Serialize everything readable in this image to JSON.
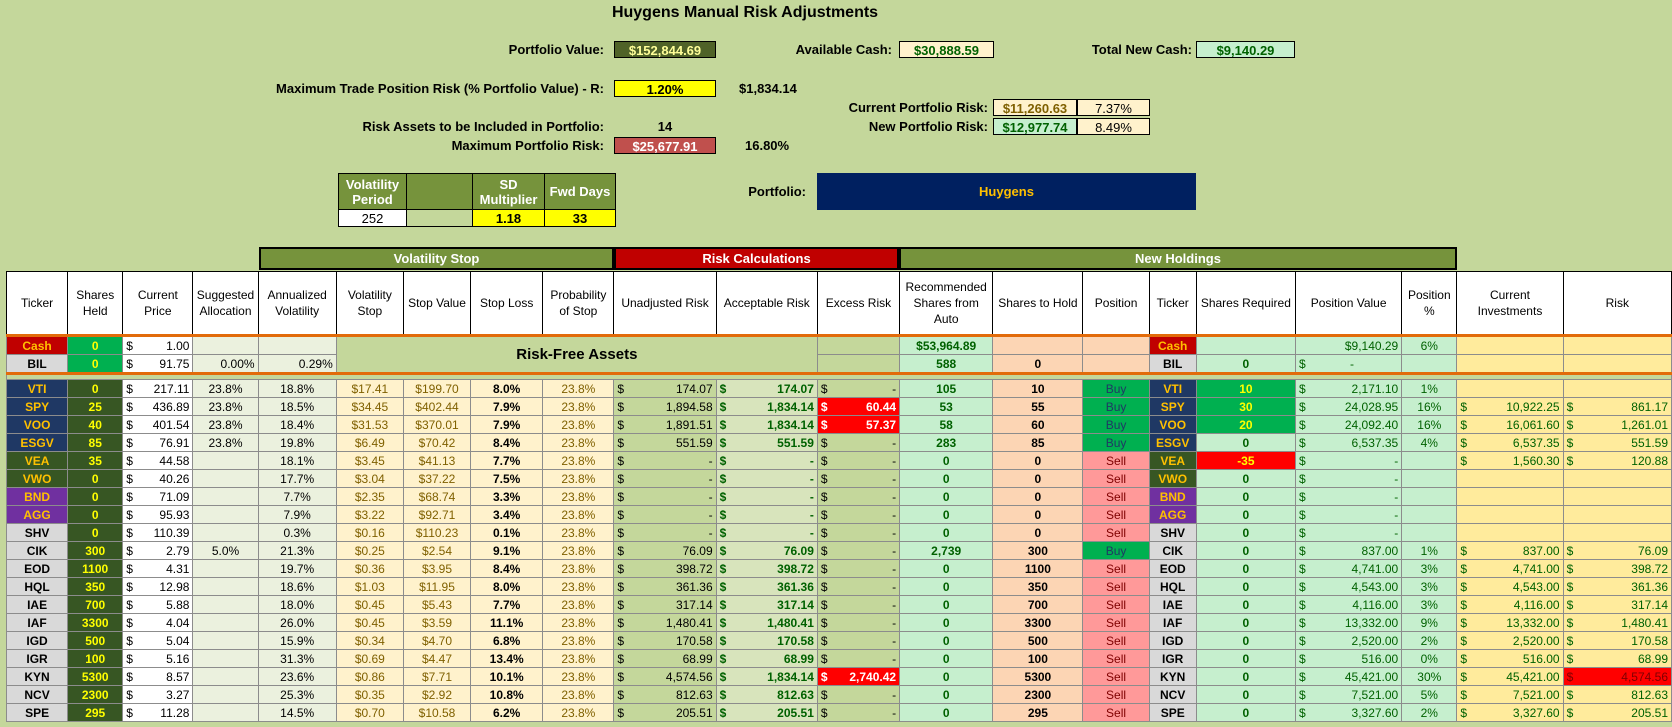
{
  "title": "Huygens Manual Risk Adjustments",
  "top": {
    "portfolio_value_label": "Portfolio Value:",
    "portfolio_value": "$152,844.69",
    "available_cash_label": "Available Cash:",
    "available_cash": "$30,888.59",
    "total_new_cash_label": "Total New Cash:",
    "total_new_cash": "$9,140.29",
    "max_trade_label": "Maximum Trade Position Risk (% Portfolio Value) - R:",
    "max_trade_pct": "1.20%",
    "max_trade_value": "$1,834.14",
    "current_risk_label": "Current Portfolio Risk:",
    "current_risk": "$11,260.63",
    "current_risk_pct": "7.37%",
    "new_risk_label": "New Portfolio Risk:",
    "new_risk": "$12,977.74",
    "new_risk_pct": "8.49%",
    "risk_assets_label": "Risk Assets to be Included in Portfolio:",
    "risk_assets": "14",
    "max_portfolio_risk_label": "Maximum Portfolio Risk:",
    "max_portfolio_risk": "$25,677.91",
    "max_portfolio_risk_pct": "16.80%",
    "portfolio_label": "Portfolio:",
    "portfolio_name": "Huygens"
  },
  "vol_params": {
    "period_label": "Volatility Period",
    "period": "252",
    "sd_label": "SD Multiplier",
    "sd": "1.18",
    "fwd_label": "Fwd Days",
    "fwd": "33"
  },
  "groups": {
    "vol_stop": "Volatility Stop",
    "risk_calc": "Risk Calculations",
    "new_holdings": "New Holdings",
    "risk_free": "Risk-Free Assets"
  },
  "headers": [
    "Ticker",
    "Shares Held",
    "Current Price",
    "Suggested Allocation",
    "Annualized Volatility",
    "Volatility Stop",
    "Stop Value",
    "Stop Loss",
    "Probability of Stop",
    "Unadjusted Risk",
    "Acceptable Risk",
    "Excess Risk",
    "Recommended Shares from Auto",
    "Shares to Hold",
    "Position",
    "Ticker",
    "Shares Required",
    "Position Value",
    "Position %",
    "Current Investments",
    "Risk"
  ],
  "risk_free_rows": [
    {
      "ticker": "Cash",
      "held": "0",
      "price": "1.00",
      "alloc": "",
      "vol": "",
      "rec": "$53,964.89",
      "hold": "",
      "pos": "",
      "ticker2": "Cash",
      "req": "",
      "pv": "$9,140.29",
      "pp": "6%",
      "ci": "",
      "risk": ""
    },
    {
      "ticker": "BIL",
      "held": "0",
      "price": "91.75",
      "alloc": "0.00%",
      "vol": "0.29%",
      "rec": "588",
      "hold": "0",
      "pos": "",
      "ticker2": "BIL",
      "req": "0",
      "pv": "-",
      "pp": "",
      "ci": "",
      "risk": ""
    }
  ],
  "rows": [
    {
      "ticker": "VTI",
      "tc": "blue",
      "held": "0",
      "price": "217.11",
      "alloc": "23.8%",
      "vol": "18.8%",
      "vstop": "$17.41",
      "sval": "$199.70",
      "sloss": "8.0%",
      "prob": "23.8%",
      "unadj": "174.07",
      "acc": "174.07",
      "exc": "-",
      "exr": false,
      "rec": "105",
      "hold": "10",
      "pos": "Buy",
      "req": "10",
      "rq": "g",
      "pv": "2,171.10",
      "pp": "1%",
      "ci": "",
      "risk": ""
    },
    {
      "ticker": "SPY",
      "tc": "blue",
      "held": "25",
      "price": "436.89",
      "alloc": "23.8%",
      "vol": "18.5%",
      "vstop": "$34.45",
      "sval": "$402.44",
      "sloss": "7.9%",
      "prob": "23.8%",
      "unadj": "1,894.58",
      "acc": "1,834.14",
      "exc": "60.44",
      "exr": true,
      "rec": "53",
      "hold": "55",
      "pos": "Buy",
      "req": "30",
      "rq": "g",
      "pv": "24,028.95",
      "pp": "16%",
      "ci": "10,922.25",
      "risk": "861.17"
    },
    {
      "ticker": "VOO",
      "tc": "blue",
      "held": "40",
      "price": "401.54",
      "alloc": "23.8%",
      "vol": "18.4%",
      "vstop": "$31.53",
      "sval": "$370.01",
      "sloss": "7.9%",
      "prob": "23.8%",
      "unadj": "1,891.51",
      "acc": "1,834.14",
      "exc": "57.37",
      "exr": true,
      "rec": "58",
      "hold": "60",
      "pos": "Buy",
      "req": "20",
      "rq": "g",
      "pv": "24,092.40",
      "pp": "16%",
      "ci": "16,061.60",
      "risk": "1,261.01"
    },
    {
      "ticker": "ESGV",
      "tc": "blue",
      "held": "85",
      "price": "76.91",
      "alloc": "23.8%",
      "vol": "19.8%",
      "vstop": "$6.49",
      "sval": "$70.42",
      "sloss": "8.4%",
      "prob": "23.8%",
      "unadj": "551.59",
      "acc": "551.59",
      "exc": "-",
      "exr": false,
      "rec": "283",
      "hold": "85",
      "pos": "Buy",
      "req": "0",
      "rq": "n",
      "pv": "6,537.35",
      "pp": "4%",
      "ci": "6,537.35",
      "risk": "551.59"
    },
    {
      "ticker": "VEA",
      "tc": "green",
      "held": "35",
      "price": "44.58",
      "alloc": "",
      "vol": "18.1%",
      "vstop": "$3.45",
      "sval": "$41.13",
      "sloss": "7.7%",
      "prob": "23.8%",
      "unadj": "-",
      "acc": "-",
      "exc": "-",
      "exr": false,
      "rec": "0",
      "hold": "0",
      "pos": "Sell",
      "req": "-35",
      "rq": "r",
      "pv": "-",
      "pp": "",
      "ci": "1,560.30",
      "risk": "120.88"
    },
    {
      "ticker": "VWO",
      "tc": "green",
      "held": "0",
      "price": "40.26",
      "alloc": "",
      "vol": "17.7%",
      "vstop": "$3.04",
      "sval": "$37.22",
      "sloss": "7.5%",
      "prob": "23.8%",
      "unadj": "-",
      "acc": "-",
      "exc": "-",
      "exr": false,
      "rec": "0",
      "hold": "0",
      "pos": "Sell",
      "req": "0",
      "rq": "n",
      "pv": "-",
      "pp": "",
      "ci": "",
      "risk": ""
    },
    {
      "ticker": "BND",
      "tc": "purple",
      "held": "0",
      "price": "71.09",
      "alloc": "",
      "vol": "7.7%",
      "vstop": "$2.35",
      "sval": "$68.74",
      "sloss": "3.3%",
      "prob": "23.8%",
      "unadj": "-",
      "acc": "-",
      "exc": "-",
      "exr": false,
      "rec": "0",
      "hold": "0",
      "pos": "Sell",
      "req": "0",
      "rq": "n",
      "pv": "-",
      "pp": "",
      "ci": "",
      "risk": ""
    },
    {
      "ticker": "AGG",
      "tc": "purple",
      "held": "0",
      "price": "95.93",
      "alloc": "",
      "vol": "7.9%",
      "vstop": "$3.22",
      "sval": "$92.71",
      "sloss": "3.4%",
      "prob": "23.8%",
      "unadj": "-",
      "acc": "-",
      "exc": "-",
      "exr": false,
      "rec": "0",
      "hold": "0",
      "pos": "Sell",
      "req": "0",
      "rq": "n",
      "pv": "-",
      "pp": "",
      "ci": "",
      "risk": ""
    },
    {
      "ticker": "SHV",
      "tc": "gray",
      "held": "0",
      "price": "110.39",
      "alloc": "",
      "vol": "0.3%",
      "vstop": "$0.16",
      "sval": "$110.23",
      "sloss": "0.1%",
      "prob": "23.8%",
      "unadj": "-",
      "acc": "-",
      "exc": "-",
      "exr": false,
      "rec": "0",
      "hold": "0",
      "pos": "Sell",
      "req": "0",
      "rq": "n",
      "pv": "-",
      "pp": "",
      "ci": "",
      "risk": ""
    },
    {
      "ticker": "CIK",
      "tc": "gray",
      "held": "300",
      "price": "2.79",
      "alloc": "5.0%",
      "vol": "21.3%",
      "vstop": "$0.25",
      "sval": "$2.54",
      "sloss": "9.1%",
      "prob": "23.8%",
      "unadj": "76.09",
      "acc": "76.09",
      "exc": "-",
      "exr": false,
      "rec": "2,739",
      "hold": "300",
      "pos": "Buy",
      "req": "0",
      "rq": "n",
      "pv": "837.00",
      "pp": "1%",
      "ci": "837.00",
      "risk": "76.09"
    },
    {
      "ticker": "EOD",
      "tc": "gray",
      "held": "1100",
      "price": "4.31",
      "alloc": "",
      "vol": "19.7%",
      "vstop": "$0.36",
      "sval": "$3.95",
      "sloss": "8.4%",
      "prob": "23.8%",
      "unadj": "398.72",
      "acc": "398.72",
      "exc": "-",
      "exr": false,
      "rec": "0",
      "hold": "1100",
      "pos": "Sell",
      "req": "0",
      "rq": "n",
      "pv": "4,741.00",
      "pp": "3%",
      "ci": "4,741.00",
      "risk": "398.72"
    },
    {
      "ticker": "HQL",
      "tc": "gray",
      "held": "350",
      "price": "12.98",
      "alloc": "",
      "vol": "18.6%",
      "vstop": "$1.03",
      "sval": "$11.95",
      "sloss": "8.0%",
      "prob": "23.8%",
      "unadj": "361.36",
      "acc": "361.36",
      "exc": "-",
      "exr": false,
      "rec": "0",
      "hold": "350",
      "pos": "Sell",
      "req": "0",
      "rq": "n",
      "pv": "4,543.00",
      "pp": "3%",
      "ci": "4,543.00",
      "risk": "361.36"
    },
    {
      "ticker": "IAE",
      "tc": "gray",
      "held": "700",
      "price": "5.88",
      "alloc": "",
      "vol": "18.0%",
      "vstop": "$0.45",
      "sval": "$5.43",
      "sloss": "7.7%",
      "prob": "23.8%",
      "unadj": "317.14",
      "acc": "317.14",
      "exc": "-",
      "exr": false,
      "rec": "0",
      "hold": "700",
      "pos": "Sell",
      "req": "0",
      "rq": "n",
      "pv": "4,116.00",
      "pp": "3%",
      "ci": "4,116.00",
      "risk": "317.14"
    },
    {
      "ticker": "IAF",
      "tc": "gray",
      "held": "3300",
      "price": "4.04",
      "alloc": "",
      "vol": "26.0%",
      "vstop": "$0.45",
      "sval": "$3.59",
      "sloss": "11.1%",
      "prob": "23.8%",
      "unadj": "1,480.41",
      "acc": "1,480.41",
      "exc": "-",
      "exr": false,
      "rec": "0",
      "hold": "3300",
      "pos": "Sell",
      "req": "0",
      "rq": "n",
      "pv": "13,332.00",
      "pp": "9%",
      "ci": "13,332.00",
      "risk": "1,480.41"
    },
    {
      "ticker": "IGD",
      "tc": "gray",
      "held": "500",
      "price": "5.04",
      "alloc": "",
      "vol": "15.9%",
      "vstop": "$0.34",
      "sval": "$4.70",
      "sloss": "6.8%",
      "prob": "23.8%",
      "unadj": "170.58",
      "acc": "170.58",
      "exc": "-",
      "exr": false,
      "rec": "0",
      "hold": "500",
      "pos": "Sell",
      "req": "0",
      "rq": "n",
      "pv": "2,520.00",
      "pp": "2%",
      "ci": "2,520.00",
      "risk": "170.58"
    },
    {
      "ticker": "IGR",
      "tc": "gray",
      "held": "100",
      "price": "5.16",
      "alloc": "",
      "vol": "31.3%",
      "vstop": "$0.69",
      "sval": "$4.47",
      "sloss": "13.4%",
      "prob": "23.8%",
      "unadj": "68.99",
      "acc": "68.99",
      "exc": "-",
      "exr": false,
      "rec": "0",
      "hold": "100",
      "pos": "Sell",
      "req": "0",
      "rq": "n",
      "pv": "516.00",
      "pp": "0%",
      "ci": "516.00",
      "risk": "68.99"
    },
    {
      "ticker": "KYN",
      "tc": "gray",
      "held": "5300",
      "price": "8.57",
      "alloc": "",
      "vol": "23.6%",
      "vstop": "$0.86",
      "sval": "$7.71",
      "sloss": "10.1%",
      "prob": "23.8%",
      "unadj": "4,574.56",
      "acc": "1,834.14",
      "exc": "2,740.42",
      "exr": true,
      "rec": "0",
      "hold": "5300",
      "pos": "Sell",
      "req": "0",
      "rq": "n",
      "pv": "45,421.00",
      "pp": "30%",
      "ci": "45,421.00",
      "risk": "4,574.56",
      "riskred": true
    },
    {
      "ticker": "NCV",
      "tc": "gray",
      "held": "2300",
      "price": "3.27",
      "alloc": "",
      "vol": "25.3%",
      "vstop": "$0.35",
      "sval": "$2.92",
      "sloss": "10.8%",
      "prob": "23.8%",
      "unadj": "812.63",
      "acc": "812.63",
      "exc": "-",
      "exr": false,
      "rec": "0",
      "hold": "2300",
      "pos": "Sell",
      "req": "0",
      "rq": "n",
      "pv": "7,521.00",
      "pp": "5%",
      "ci": "7,521.00",
      "risk": "812.63"
    },
    {
      "ticker": "SPE",
      "tc": "gray",
      "held": "295",
      "price": "11.28",
      "alloc": "",
      "vol": "14.5%",
      "vstop": "$0.70",
      "sval": "$10.58",
      "sloss": "6.2%",
      "prob": "23.8%",
      "unadj": "205.51",
      "acc": "205.51",
      "exc": "-",
      "exr": false,
      "rec": "0",
      "hold": "295",
      "pos": "Sell",
      "req": "0",
      "rq": "n",
      "pv": "3,327.60",
      "pp": "2%",
      "ci": "3,327.60",
      "risk": "205.51"
    }
  ]
}
